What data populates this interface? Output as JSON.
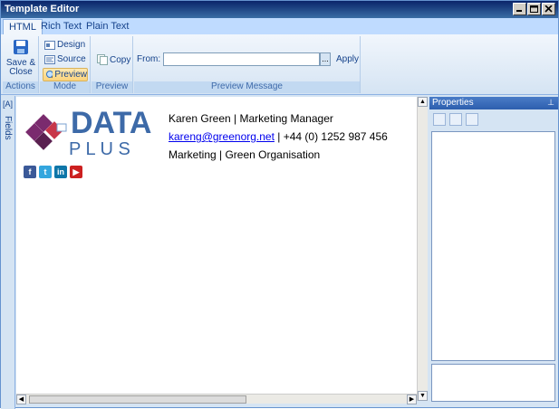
{
  "window": {
    "title": "Template Editor"
  },
  "tabs": [
    {
      "label": "HTML"
    },
    {
      "label": "Rich Text"
    },
    {
      "label": "Plain Text"
    }
  ],
  "ribbon": {
    "actions": {
      "save_close": "Save & Close",
      "group": "Actions"
    },
    "mode": {
      "design": "Design",
      "source": "Source",
      "preview": "Preview",
      "group": "Mode"
    },
    "preview": {
      "copy": "Copy",
      "group": "Preview"
    },
    "preview_message": {
      "from_label": "From:",
      "from_value": "",
      "ellipsis": "...",
      "apply": "Apply",
      "group": "Preview Message"
    }
  },
  "fields_panel": {
    "label": "Fields"
  },
  "signature": {
    "logo_line1": "DATA",
    "logo_line2": "P L U S",
    "line1": "Karen Green | Marketing Manager",
    "email": "kareng@greenorg.net",
    "phone": " | +44 (0) 1252 987 456",
    "line3": "Marketing | Green Organisation",
    "social": [
      "facebook-icon",
      "twitter-icon",
      "linkedin-icon",
      "youtube-icon"
    ]
  },
  "properties": {
    "title": "Properties"
  },
  "colors": {
    "accent": "#15428b",
    "logo_blue": "#3d6aa8",
    "logo_purple": "#7a2b6e",
    "logo_red": "#c8364a"
  }
}
